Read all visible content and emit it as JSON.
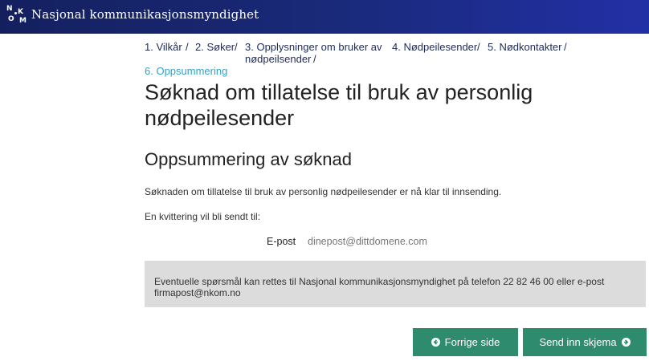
{
  "header": {
    "logo_letters": [
      "N",
      "K",
      "O",
      "M"
    ],
    "title": "Nasjonal kommunikasjonsmyndighet"
  },
  "breadcrumb": {
    "steps": [
      "1. Vilkår",
      "2. Søker",
      "3. Opplysninger om bruker av",
      "nødpeilsender",
      "4. Nødpeilesender",
      "5. Nødkontakter",
      "6. Oppsummering"
    ],
    "separator": "/"
  },
  "page": {
    "title_line1": "Søknad om tillatelse til bruk av personlig",
    "title_line2": "nødpeilesender",
    "section_title": "Oppsummering av søknad",
    "ready_text": "Søknaden om tillatelse til bruk av personlig nødpeilesender er nå klar til innsending.",
    "receipt_text": "En kvittering vil bli sendt til:",
    "email_label": "E-post",
    "email_value": "dinepost@dittdomene.com",
    "info_line1": "Eventuelle spørsmål kan rettes til Nasjonal kommunikasjonsmyndighet på telefon 22 82 46 00 eller e-post",
    "info_line2": "firmapost@nkom.no"
  },
  "buttons": {
    "prev_label": "Forrige side",
    "next_label": "Send inn skjema"
  },
  "colors": {
    "header_bg": "#1a2a7c",
    "button_bg": "#2e8b6e",
    "active_step": "#2ea3c6",
    "info_box_bg": "#dcdcdc"
  },
  "icons": {
    "prev": "circle-arrow-left-icon",
    "next": "circle-arrow-right-icon"
  }
}
